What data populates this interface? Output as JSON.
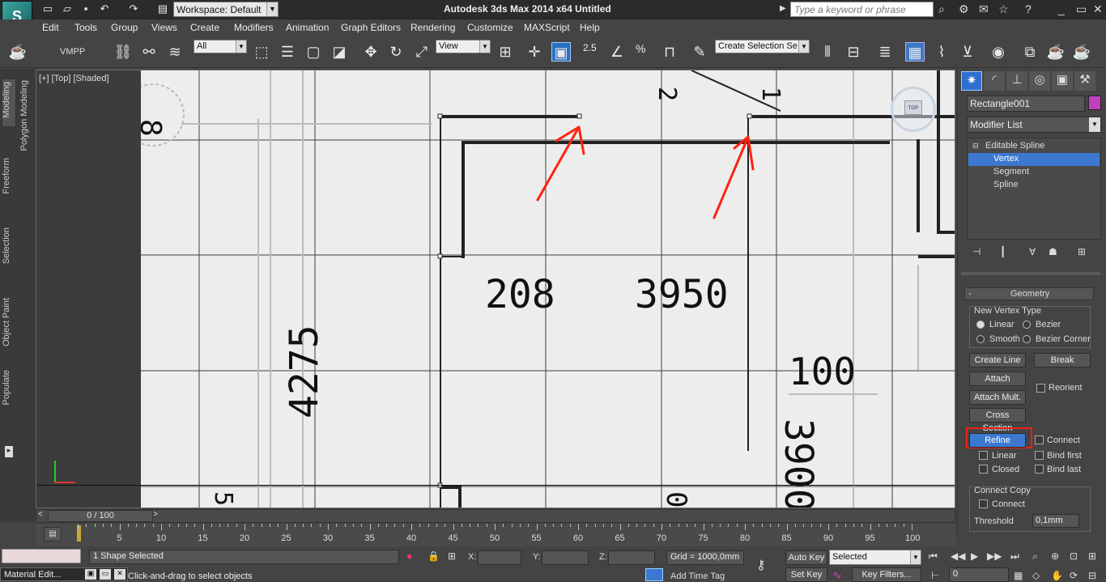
{
  "app": {
    "logo_letter": "S",
    "title": "Autodesk 3ds Max  2014 x64      Untitled",
    "workspace": "Workspace: Default",
    "search_placeholder": "Type a keyword or phrase"
  },
  "menu": [
    "Edit",
    "Tools",
    "Group",
    "Views",
    "Create",
    "Modifiers",
    "Animation",
    "Graph Editors",
    "Rendering",
    "Customize",
    "MAXScript",
    "Help"
  ],
  "toolbar": {
    "vmpp": "VMPP",
    "filter": "All",
    "ref_coord": "View",
    "snap_angle": "2.5",
    "percent": "%",
    "named_selection": "Create Selection Se"
  },
  "left_tabs": [
    "Modeling",
    "Polygon Modeling",
    "Freeform",
    "Selection",
    "Object Paint",
    "Populate"
  ],
  "viewport": {
    "label": "[+] [Top] [Shaded]",
    "dims": [
      "208",
      "3950",
      "4275",
      "3900",
      "100",
      "2",
      "1",
      "8",
      "5",
      "0"
    ],
    "viewcube": "TOP"
  },
  "command_panel": {
    "object_name": "Rectangle001",
    "object_color": "#c040c0",
    "modifier_list": "Modifier List",
    "stack": [
      {
        "label": "Editable Spline",
        "level": 0
      },
      {
        "label": "Vertex",
        "level": 1,
        "selected": true
      },
      {
        "label": "Segment",
        "level": 1
      },
      {
        "label": "Spline",
        "level": 1
      }
    ],
    "rollout_title": "Geometry",
    "new_vertex_type": "New Vertex Type",
    "vertex_types": [
      "Linear",
      "Bezier",
      "Smooth",
      "Bezier Corner"
    ],
    "buttons": {
      "create_line": "Create Line",
      "break": "Break",
      "attach": "Attach",
      "reorient": "Reorient",
      "attach_mult": "Attach Mult.",
      "cross_section": "Cross Section",
      "refine": "Refine",
      "connect": "Connect",
      "linear": "Linear",
      "bind_first": "Bind first",
      "closed": "Closed",
      "bind_last": "Bind last"
    },
    "connect_copy": "Connect Copy",
    "connect_copy_check": "Connect",
    "threshold_label": "Threshold",
    "threshold_value": "0,1mm"
  },
  "timeline": {
    "frame_counter": "0 / 100",
    "ticks": [
      "5",
      "10",
      "15",
      "20",
      "25",
      "30",
      "35",
      "40",
      "45",
      "50",
      "55",
      "60",
      "65",
      "70",
      "75",
      "80",
      "85",
      "90",
      "95",
      "100"
    ]
  },
  "status": {
    "shapes_selected": "1 Shape Selected",
    "prompt": "Click-and-drag to select objects",
    "x_label": "X:",
    "y_label": "Y:",
    "z_label": "Z:",
    "grid": "Grid = 1000,0mm",
    "auto_key": "Auto Key",
    "set_key": "Set Key",
    "selected_filter": "Selected",
    "key_filters": "Key Filters...",
    "add_time_tag": "Add Time Tag",
    "frame": "0",
    "material_editor_tab": "Material Edit..."
  }
}
